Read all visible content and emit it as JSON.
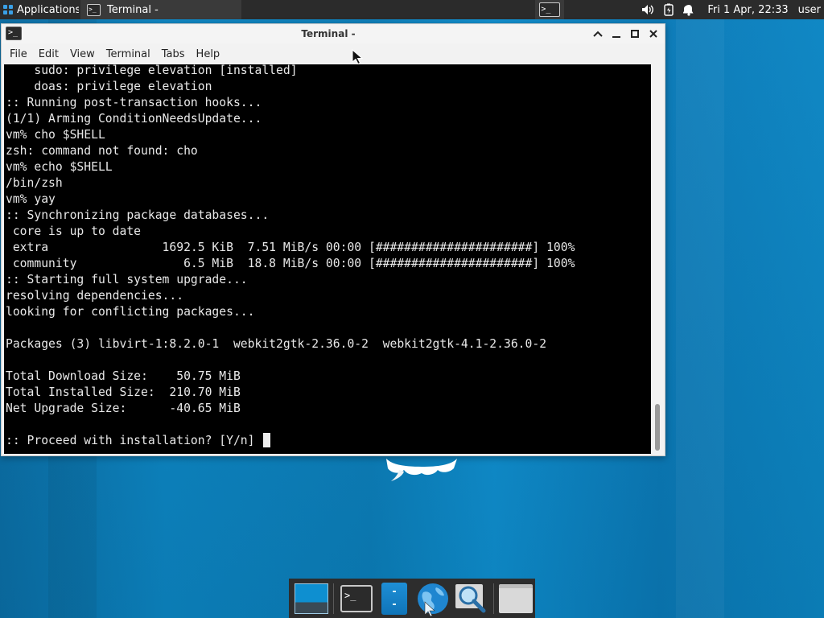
{
  "top_panel": {
    "applications_label": "Applications",
    "task_label": "Terminal -",
    "clock": "Fri  1 Apr, 22:33",
    "user": "user"
  },
  "window": {
    "title": "Terminal -",
    "menu": [
      "File",
      "Edit",
      "View",
      "Terminal",
      "Tabs",
      "Help"
    ]
  },
  "terminal": {
    "lines": [
      "    sudo: privilege elevation [installed]",
      "    doas: privilege elevation",
      ":: Running post-transaction hooks...",
      "(1/1) Arming ConditionNeedsUpdate...",
      "vm% cho $SHELL",
      "zsh: command not found: cho",
      "vm% echo $SHELL",
      "/bin/zsh",
      "vm% yay",
      ":: Synchronizing package databases...",
      " core is up to date",
      " extra                1692.5 KiB  7.51 MiB/s 00:00 [######################] 100%",
      " community               6.5 MiB  18.8 MiB/s 00:00 [######################] 100%",
      ":: Starting full system upgrade...",
      "resolving dependencies...",
      "looking for conflicting packages...",
      "",
      "Packages (3) libvirt-1:8.2.0-1  webkit2gtk-2.36.0-2  webkit2gtk-4.1-2.36.0-2",
      "",
      "Total Download Size:    50.75 MiB",
      "Total Installed Size:  210.70 MiB",
      "Net Upgrade Size:      -40.65 MiB",
      "",
      ":: Proceed with installation? [Y/n] "
    ]
  },
  "dock": {
    "items": [
      "show-desktop",
      "terminal",
      "file-manager",
      "web-browser",
      "app-finder",
      "home-folder"
    ]
  }
}
